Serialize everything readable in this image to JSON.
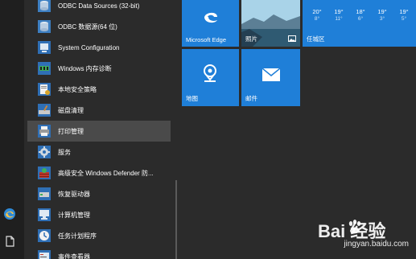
{
  "app_list": {
    "items": [
      {
        "label": "ODBC Data Sources (32-bit)",
        "icon": "odbc-icon"
      },
      {
        "label": "ODBC 数据源(64 位)",
        "icon": "odbc-icon"
      },
      {
        "label": "System Configuration",
        "icon": "system-config-icon"
      },
      {
        "label": "Windows 内存诊断",
        "icon": "memory-diagnostic-icon"
      },
      {
        "label": "本地安全策略",
        "icon": "security-policy-icon"
      },
      {
        "label": "磁盘清理",
        "icon": "disk-cleanup-icon"
      },
      {
        "label": "打印管理",
        "icon": "print-management-icon"
      },
      {
        "label": "服务",
        "icon": "services-gear-icon"
      },
      {
        "label": "高级安全 Windows Defender 防...",
        "icon": "firewall-icon"
      },
      {
        "label": "恢复驱动器",
        "icon": "recovery-drive-icon"
      },
      {
        "label": "计算机管理",
        "icon": "computer-management-icon"
      },
      {
        "label": "任务计划程序",
        "icon": "task-scheduler-icon"
      },
      {
        "label": "事件查看器",
        "icon": "event-viewer-icon"
      }
    ],
    "highlighted_index": 6
  },
  "tiles": {
    "edge": {
      "label": "Microsoft Edge"
    },
    "photos": {
      "label": "照片"
    },
    "maps": {
      "label": "地图"
    },
    "mail": {
      "label": "邮件"
    },
    "weather": {
      "location": "任城区",
      "days": [
        {
          "high": "20°",
          "low": "8°"
        },
        {
          "high": "19°",
          "low": "11°"
        },
        {
          "high": "18°",
          "low": "6°"
        },
        {
          "high": "19°",
          "low": "3°"
        },
        {
          "high": "19°",
          "low": "5°"
        }
      ]
    }
  },
  "watermark": {
    "brand": "Bai  经验",
    "url": "jingyan.baidu.com"
  },
  "colors": {
    "tile_blue": "#1f7fd8",
    "background": "#2b2b2b",
    "highlight": "#4a4a4a"
  }
}
